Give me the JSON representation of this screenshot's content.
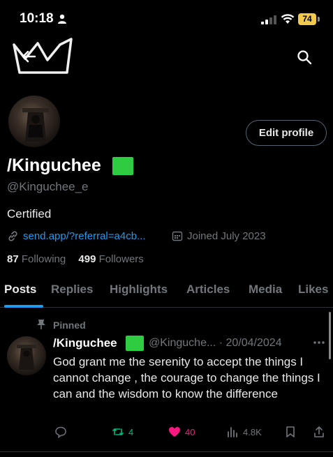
{
  "status_bar": {
    "time": "10:18",
    "battery": "74"
  },
  "profile": {
    "edit_label": "Edit profile",
    "display_name": "/Kinguchee",
    "handle": "@Kinguchee_e",
    "bio": "Certified",
    "link": "send.app/?referral=a4cb...",
    "joined": "Joined July 2023",
    "following_count": "87",
    "following_label": "Following",
    "followers_count": "499",
    "followers_label": "Followers"
  },
  "tabs": [
    {
      "label": "Posts"
    },
    {
      "label": "Replies"
    },
    {
      "label": "Highlights"
    },
    {
      "label": "Articles"
    },
    {
      "label": "Media"
    },
    {
      "label": "Likes"
    }
  ],
  "pinned_post": {
    "pinned_label": "Pinned",
    "name": "/Kinguchee",
    "meta": "@Kinguche... · 20/04/2024",
    "text": "God grant me the serenity to accept the things I cannot change , the courage to change the things I can  and the wisdom to know the difference",
    "retweets": "4",
    "likes": "40",
    "views": "4.8K"
  },
  "colors": {
    "accent": "#1d9bf0",
    "badge": "#2ecc40",
    "retweet": "#00ba7c",
    "like": "#f91880",
    "battery": "#f2c94c"
  },
  "icons": [
    "person-icon",
    "signal-icon",
    "wifi-icon",
    "crown-icon",
    "back-arrow-icon",
    "search-icon",
    "link-icon",
    "calendar-icon",
    "pin-icon",
    "more-icon",
    "reply-icon",
    "retweet-icon",
    "heart-icon",
    "views-icon",
    "bookmark-icon",
    "share-icon"
  ]
}
